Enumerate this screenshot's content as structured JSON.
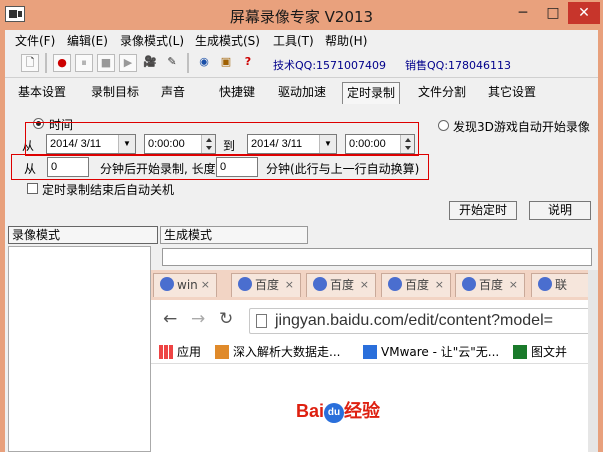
{
  "window": {
    "title": "屏幕录像专家 V2013",
    "minimize": "─",
    "maximize": "□",
    "close": "✕"
  },
  "menu": [
    "文件(F)",
    "编辑(E)",
    "录像模式(L)",
    "生成模式(S)",
    "工具(T)",
    "帮助(H)"
  ],
  "toolbar": {
    "buttons": [
      "new-icon",
      "record-icon",
      "pause-icon",
      "stop-icon",
      "play-icon",
      "camera-icon",
      "wand-icon",
      "globe-icon",
      "package-icon",
      "help-icon"
    ],
    "tech_qq": "技术QQ:1571007409",
    "sales_qq": "销售QQ:178046113"
  },
  "tabs": [
    "基本设置",
    "录制目标",
    "声音",
    "快捷键",
    "驱动加速",
    "定时录制",
    "文件分割",
    "其它设置"
  ],
  "active_tab": "定时录制",
  "timer": {
    "time_label": "时间",
    "from_label": "从",
    "to_label": "到",
    "start_date": "2014/ 3/11",
    "start_time": "0:00:00",
    "end_date": "2014/ 3/11",
    "end_time": "0:00:00",
    "from2_label": "从",
    "minutes_start": "0",
    "minutes_text": "分钟后开始录制, 长度",
    "length_value": "0",
    "length_text": "分钟(此行与上一行自动换算)",
    "auto_shutdown": "定时录制结束后自动关机",
    "game_detect": "发现3D游戏自动开始录像",
    "start_timer_btn": "开始定时",
    "help_btn": "说明"
  },
  "lower_tabs": [
    "录像模式",
    "生成模式"
  ],
  "browser": {
    "tabs": [
      "win",
      "百度",
      "百度",
      "百度",
      "百度",
      "联"
    ],
    "url": "jingyan.baidu.com/edit/content?model=",
    "bookmarks": [
      "应用",
      "深入解析大数据走...",
      "VMware - 让\"云\"无...",
      "图文并"
    ],
    "logo_bai": "Bai",
    "logo_du": "du",
    "logo_jingyan": "经验"
  }
}
